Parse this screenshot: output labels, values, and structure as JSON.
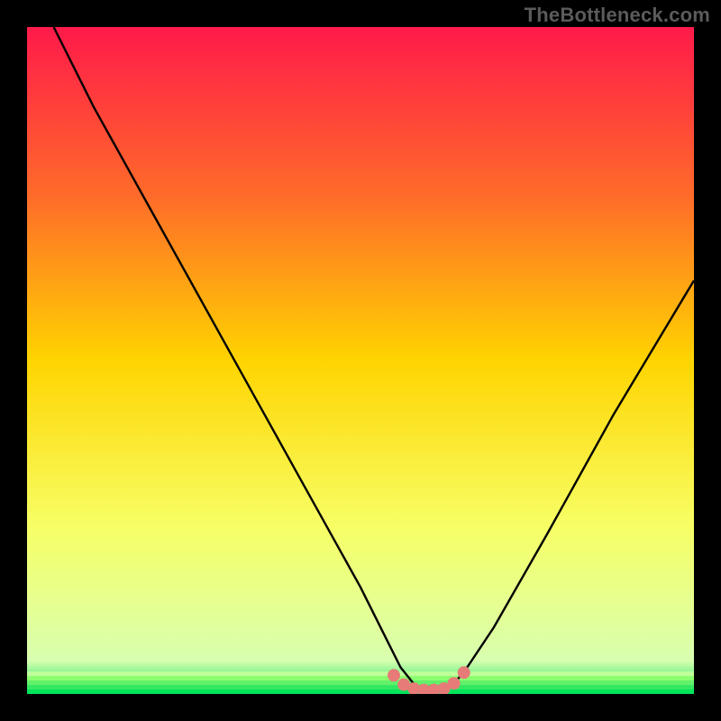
{
  "watermark": "TheBottleneck.com",
  "chart_data": {
    "type": "line",
    "title": "",
    "xlabel": "",
    "ylabel": "",
    "xlim": [
      0,
      100
    ],
    "ylim": [
      0,
      100
    ],
    "x": [
      4,
      10,
      20,
      30,
      40,
      50,
      54,
      56,
      58,
      60,
      62,
      64,
      66,
      70,
      78,
      88,
      100
    ],
    "y": [
      100,
      88,
      70,
      52,
      34,
      16,
      8,
      4,
      1.5,
      0.5,
      0.5,
      1.5,
      4,
      10,
      24,
      42,
      62
    ],
    "series": [
      {
        "name": "bottleneck-curve",
        "x": [
          4,
          10,
          20,
          30,
          40,
          50,
          54,
          56,
          58,
          60,
          62,
          64,
          66,
          70,
          78,
          88,
          100
        ],
        "y": [
          100,
          88,
          70,
          52,
          34,
          16,
          8,
          4,
          1.5,
          0.5,
          0.5,
          1.5,
          4,
          10,
          24,
          42,
          62
        ]
      }
    ],
    "gradient_bands": [
      {
        "y": 0,
        "color": "#ff1a4a"
      },
      {
        "y": 0.25,
        "color": "#ff6a2a"
      },
      {
        "y": 0.5,
        "color": "#ffd400"
      },
      {
        "y": 0.75,
        "color": "#f7ff66"
      },
      {
        "y": 0.95,
        "color": "#d8ffb0"
      },
      {
        "y": 1.0,
        "color": "#00e45a"
      }
    ],
    "marker": {
      "color": "#e77b78",
      "points_x": [
        55,
        56.5,
        58,
        59.5,
        61,
        62.5,
        64,
        65.5
      ],
      "points_y": [
        2.8,
        1.4,
        0.8,
        0.6,
        0.6,
        0.8,
        1.6,
        3.2
      ]
    }
  }
}
